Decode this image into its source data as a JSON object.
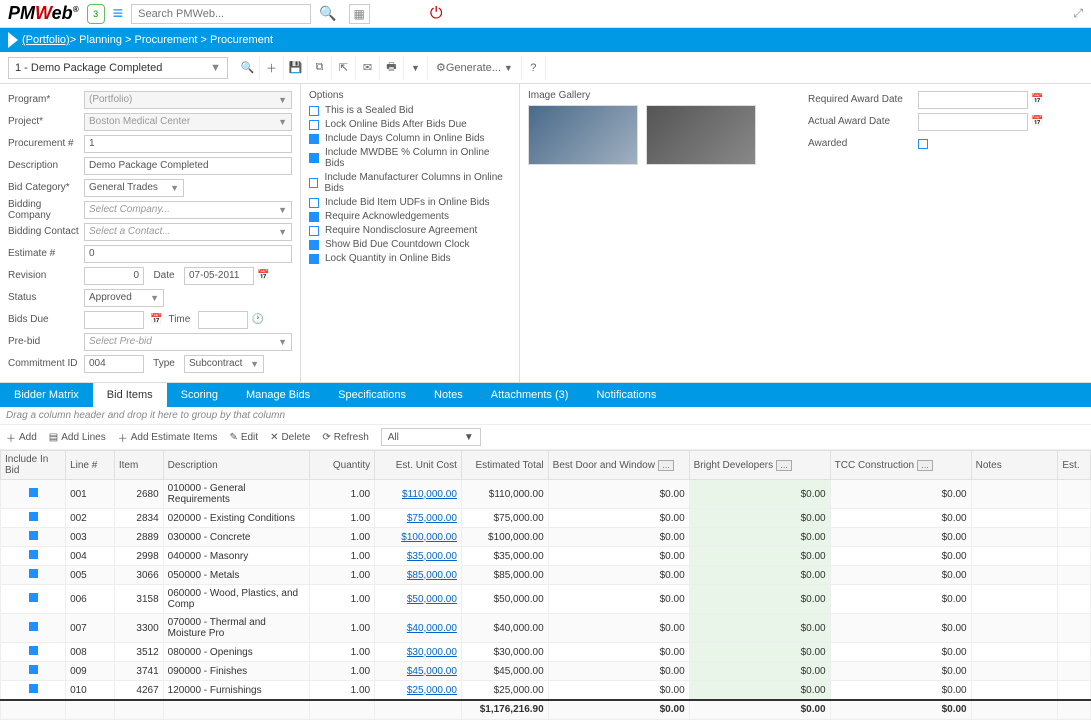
{
  "header": {
    "logo_pm": "PM",
    "logo_w": "W",
    "logo_eb": "eb",
    "badge": "3",
    "search_placeholder": "Search PMWeb..."
  },
  "breadcrumb": {
    "portfolio": "(Portfolio)",
    "rest": " > Planning > Procurement > Procurement"
  },
  "record_select": "1 - Demo Package Completed",
  "generate": "Generate...",
  "form": {
    "program_lbl": "Program*",
    "program_val": "(Portfolio)",
    "project_lbl": "Project*",
    "project_val": "Boston Medical Center",
    "procnum_lbl": "Procurement #",
    "procnum_val": "1",
    "desc_lbl": "Description",
    "desc_val": "Demo Package Completed",
    "bidcat_lbl": "Bid Category*",
    "bidcat_val": "General Trades",
    "bidcomp_lbl": "Bidding Company",
    "bidcomp_val": "Select Company...",
    "bidcont_lbl": "Bidding Contact",
    "bidcont_val": "Select a Contact...",
    "estnum_lbl": "Estimate #",
    "estnum_val": "0",
    "rev_lbl": "Revision",
    "rev_val": "0",
    "date_lbl": "Date",
    "date_val": "07-05-2011",
    "status_lbl": "Status",
    "status_val": "Approved",
    "bidsdue_lbl": "Bids Due",
    "time_lbl": "Time",
    "prebid_lbl": "Pre-bid",
    "prebid_val": "Select Pre-bid",
    "commit_lbl": "Commitment ID",
    "commit_val": "004",
    "type_lbl": "Type",
    "type_val": "Subcontract"
  },
  "options": {
    "title": "Options",
    "items": [
      {
        "label": "This is a Sealed Bid",
        "checked": false
      },
      {
        "label": "Lock Online Bids After Bids Due",
        "checked": false
      },
      {
        "label": "Include Days Column in Online Bids",
        "checked": true
      },
      {
        "label": "Include MWDBE % Column in Online Bids",
        "checked": true
      },
      {
        "label": "Include Manufacturer Columns in Online Bids",
        "checked": false
      },
      {
        "label": "Include Bid Item UDFs in Online Bids",
        "checked": false
      },
      {
        "label": "Require Acknowledgements",
        "checked": true
      },
      {
        "label": "Require Nondisclosure Agreement",
        "checked": false
      },
      {
        "label": "Show Bid Due Countdown Clock",
        "checked": true
      },
      {
        "label": "Lock Quantity in Online Bids",
        "checked": true
      }
    ]
  },
  "gallery_title": "Image Gallery",
  "right_form": {
    "req_award_lbl": "Required Award Date",
    "act_award_lbl": "Actual Award Date",
    "awarded_lbl": "Awarded"
  },
  "tabs": [
    "Bidder Matrix",
    "Bid Items",
    "Scoring",
    "Manage Bids",
    "Specifications",
    "Notes",
    "Attachments (3)",
    "Notifications"
  ],
  "group_hint": "Drag a column header and drop it here to group by that column",
  "grid_toolbar": {
    "add": "Add",
    "add_lines": "Add Lines",
    "add_est": "Add Estimate Items",
    "edit": "Edit",
    "delete": "Delete",
    "refresh": "Refresh",
    "filter": "All"
  },
  "grid_headers": {
    "inc": "Include In Bid",
    "line": "Line #",
    "item": "Item",
    "desc": "Description",
    "qty": "Quantity",
    "unit": "Est. Unit Cost",
    "est": "Estimated Total",
    "bid1": "Best Door and Window",
    "bid2": "Bright Developers",
    "bid3": "TCC Construction",
    "notes": "Notes",
    "est2": "Est."
  },
  "grid_rows": [
    {
      "line": "001",
      "item": "2680",
      "desc": "010000 - General Requirements",
      "qty": "1.00",
      "unit": "$110,000.00",
      "est": "$110,000.00",
      "b1": "$0.00",
      "b2": "$0.00",
      "b3": "$0.00"
    },
    {
      "line": "002",
      "item": "2834",
      "desc": "020000 - Existing Conditions",
      "qty": "1.00",
      "unit": "$75,000.00",
      "est": "$75,000.00",
      "b1": "$0.00",
      "b2": "$0.00",
      "b3": "$0.00"
    },
    {
      "line": "003",
      "item": "2889",
      "desc": "030000 - Concrete",
      "qty": "1.00",
      "unit": "$100,000.00",
      "est": "$100,000.00",
      "b1": "$0.00",
      "b2": "$0.00",
      "b3": "$0.00"
    },
    {
      "line": "004",
      "item": "2998",
      "desc": "040000 - Masonry",
      "qty": "1.00",
      "unit": "$35,000.00",
      "est": "$35,000.00",
      "b1": "$0.00",
      "b2": "$0.00",
      "b3": "$0.00"
    },
    {
      "line": "005",
      "item": "3066",
      "desc": "050000 - Metals",
      "qty": "1.00",
      "unit": "$85,000.00",
      "est": "$85,000.00",
      "b1": "$0.00",
      "b2": "$0.00",
      "b3": "$0.00"
    },
    {
      "line": "006",
      "item": "3158",
      "desc": "060000 - Wood, Plastics, and Comp",
      "qty": "1.00",
      "unit": "$50,000.00",
      "est": "$50,000.00",
      "b1": "$0.00",
      "b2": "$0.00",
      "b3": "$0.00"
    },
    {
      "line": "007",
      "item": "3300",
      "desc": "070000 - Thermal and Moisture Pro",
      "qty": "1.00",
      "unit": "$40,000.00",
      "est": "$40,000.00",
      "b1": "$0.00",
      "b2": "$0.00",
      "b3": "$0.00"
    },
    {
      "line": "008",
      "item": "3512",
      "desc": "080000 - Openings",
      "qty": "1.00",
      "unit": "$30,000.00",
      "est": "$30,000.00",
      "b1": "$0.00",
      "b2": "$0.00",
      "b3": "$0.00"
    },
    {
      "line": "009",
      "item": "3741",
      "desc": "090000 - Finishes",
      "qty": "1.00",
      "unit": "$45,000.00",
      "est": "$45,000.00",
      "b1": "$0.00",
      "b2": "$0.00",
      "b3": "$0.00"
    },
    {
      "line": "010",
      "item": "4267",
      "desc": "120000 - Furnishings",
      "qty": "1.00",
      "unit": "$25,000.00",
      "est": "$25,000.00",
      "b1": "$0.00",
      "b2": "$0.00",
      "b3": "$0.00"
    }
  ],
  "grid_total": {
    "est": "$1,176,216.90",
    "b1": "$0.00",
    "b2": "$0.00",
    "b3": "$0.00"
  }
}
